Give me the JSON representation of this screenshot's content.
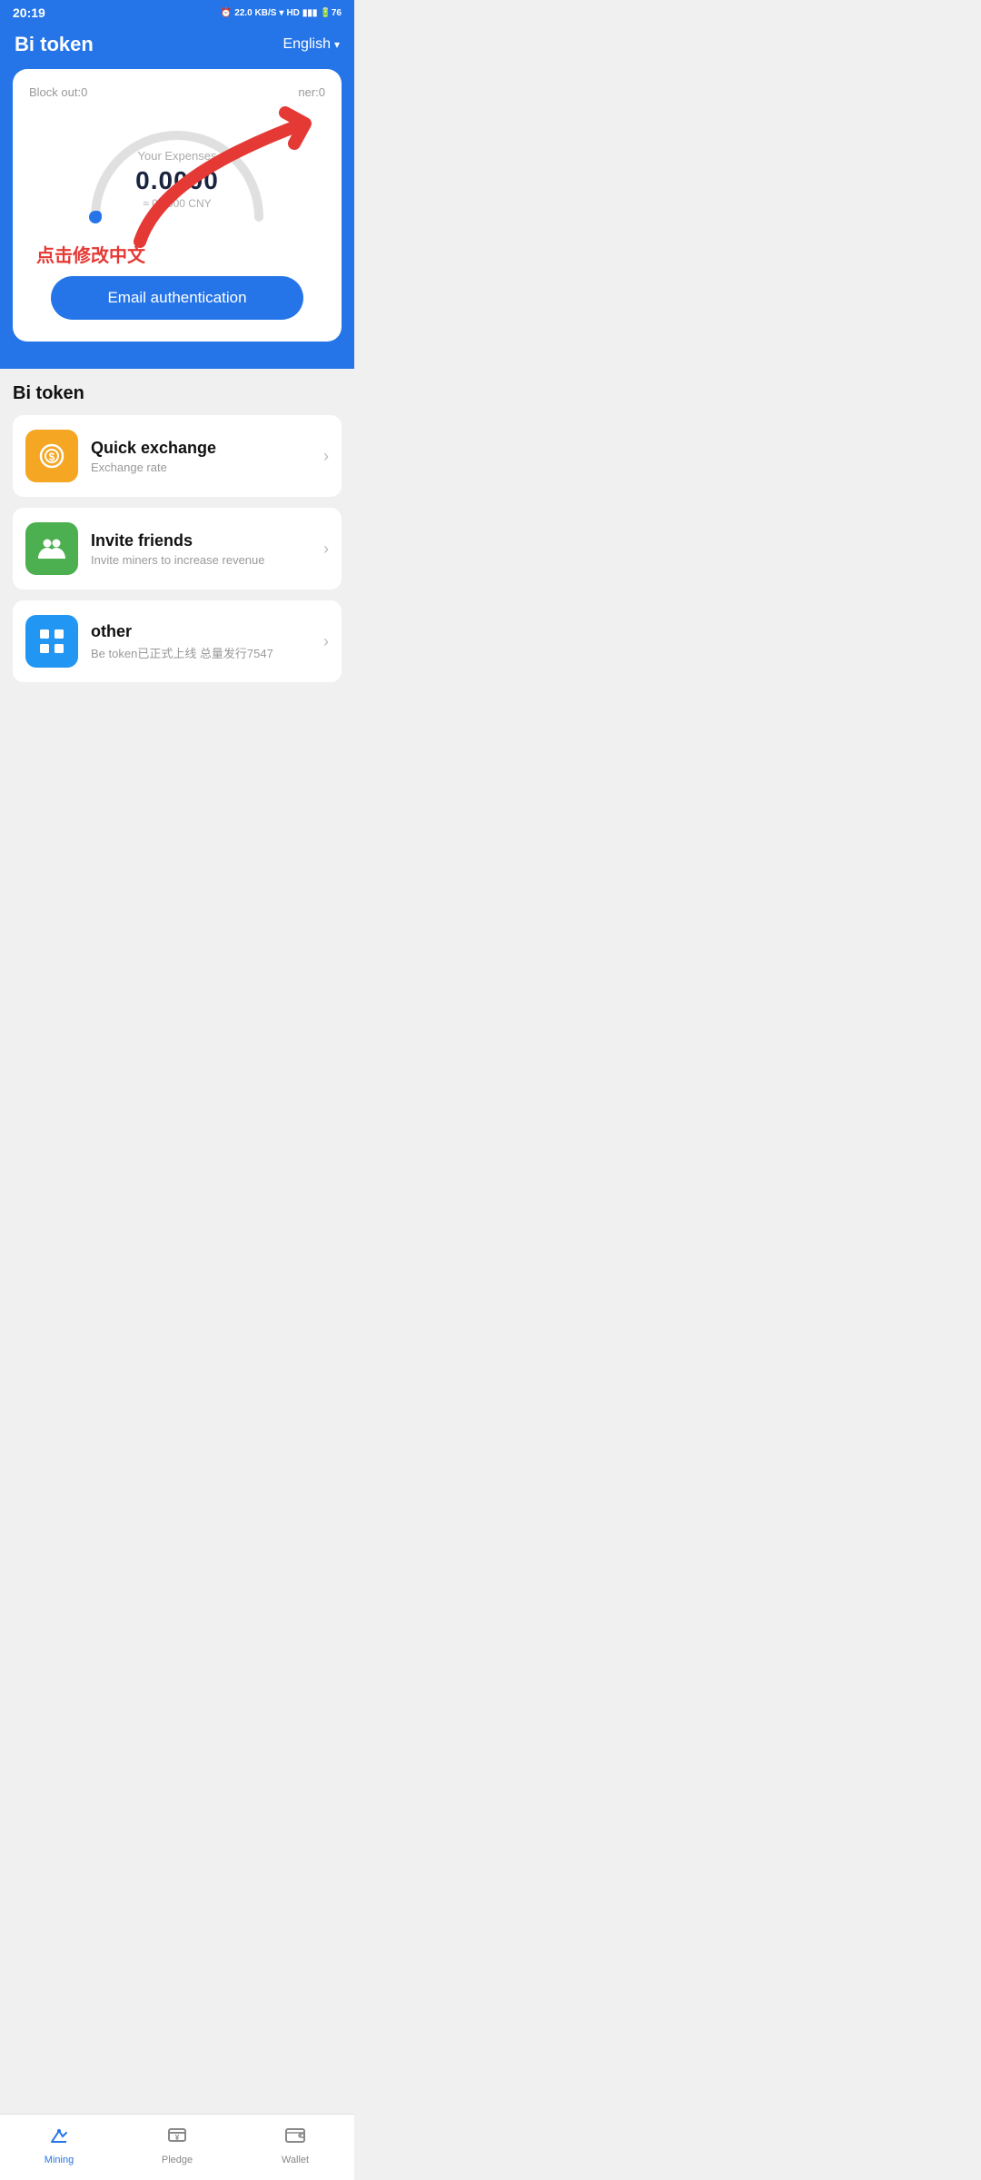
{
  "statusBar": {
    "time": "20:19",
    "icons": "⏰ 22.0 KB/S ▾ HD 4G▮▮ 4G▮▮ 76"
  },
  "header": {
    "title": "Bi token",
    "language": "English",
    "chevron": "▾"
  },
  "card": {
    "blockOut": "Block out:0",
    "minerLabel": "ner:0",
    "expensesLabel": "Your Expenses",
    "expensesValue": "0.0000",
    "cnyLabel": "≈ 0.0000 CNY",
    "annotationChinese": "点击修改中文",
    "emailBtnLabel": "Email authentication"
  },
  "sectionTitle": "Bi token",
  "listItems": [
    {
      "iconColor": "orange",
      "iconSymbol": "💰",
      "title": "Quick exchange",
      "subtitle": "Exchange rate"
    },
    {
      "iconColor": "green",
      "iconSymbol": "👥",
      "title": "Invite friends",
      "subtitle": "Invite miners to increase revenue"
    },
    {
      "iconColor": "blue",
      "iconSymbol": "⊞",
      "title": "other",
      "subtitle": "Be token已正式上线 总量发行7547"
    }
  ],
  "bottomNav": [
    {
      "icon": "⛏",
      "label": "Mining",
      "active": true
    },
    {
      "icon": "¥",
      "label": "Pledge",
      "active": false
    },
    {
      "icon": "👜",
      "label": "Wallet",
      "active": false
    }
  ]
}
